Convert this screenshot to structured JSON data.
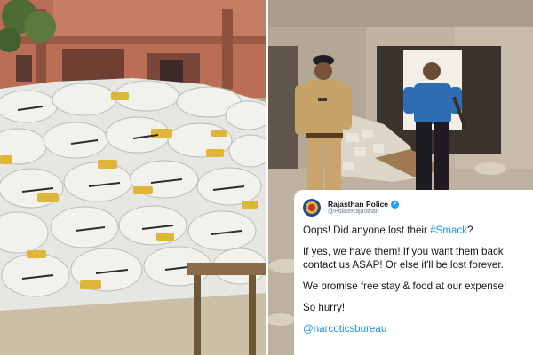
{
  "tweet": {
    "display_name": "Rajasthan Police",
    "handle": "@PoliceRajasthan",
    "line1_prefix": "Oops! Did anyone lost their ",
    "line1_hashtag": "#Smack",
    "line1_suffix": "?",
    "line2": "If yes, we have them! If you want them back contact us ASAP! Or else it'll be lost forever.",
    "line3": "We promise free stay & food at our expense!",
    "line4": "So hurry!",
    "mention": "@narcoticsbureau"
  },
  "icons": {
    "avatar": "police-emblem-icon",
    "verified": "verified-badge-icon"
  },
  "colors": {
    "link": "#1b95e0",
    "verified": "#1da1f2",
    "text": "#14171a",
    "muted": "#657786"
  }
}
